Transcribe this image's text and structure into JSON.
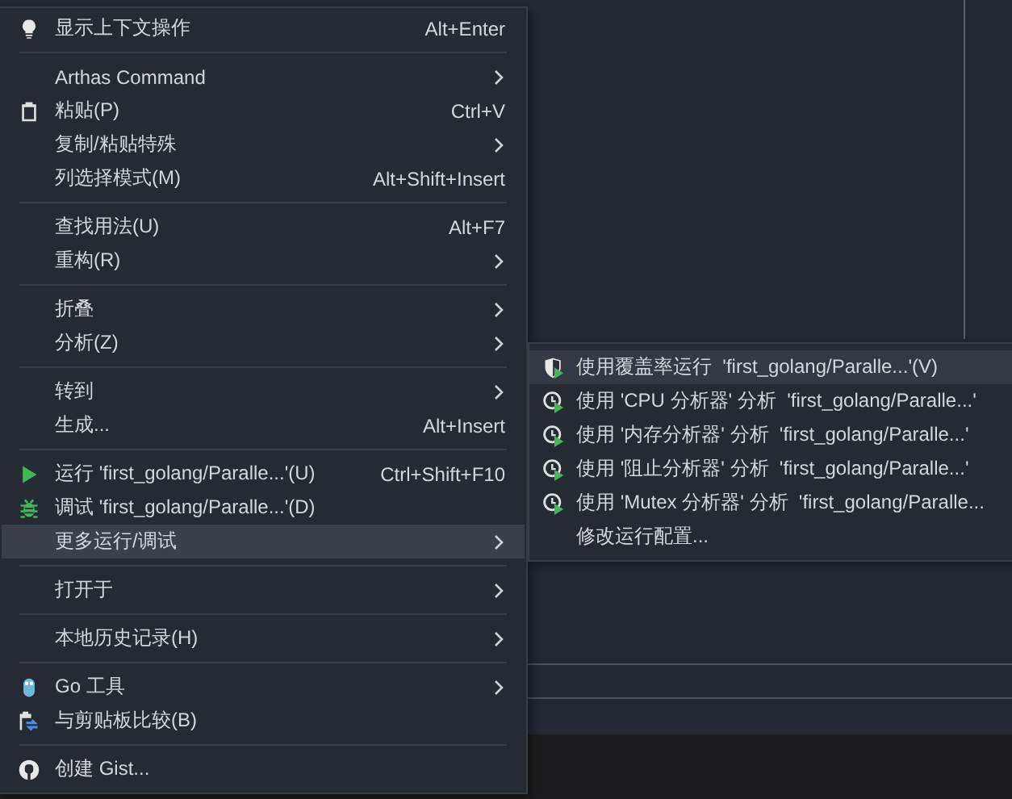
{
  "context_menu": {
    "groups": [
      [
        {
          "kind": "bulb",
          "label": "显示上下文操作",
          "shortcut": "Alt+Enter",
          "has_submenu": false,
          "selected": false
        }
      ],
      [
        {
          "label": "Arthas Command",
          "has_submenu": true,
          "selected": false
        },
        {
          "kind": "clipboard",
          "label": "粘贴(P)",
          "shortcut": "Ctrl+V",
          "has_submenu": false,
          "selected": false
        },
        {
          "label": "复制/粘贴特殊",
          "has_submenu": true,
          "selected": false
        },
        {
          "label": "列选择模式(M)",
          "shortcut": "Alt+Shift+Insert",
          "has_submenu": false,
          "selected": false
        }
      ],
      [
        {
          "label": "查找用法(U)",
          "shortcut": "Alt+F7",
          "has_submenu": false,
          "selected": false
        },
        {
          "label": "重构(R)",
          "has_submenu": true,
          "selected": false
        }
      ],
      [
        {
          "label": "折叠",
          "has_submenu": true,
          "selected": false
        },
        {
          "label": "分析(Z)",
          "has_submenu": true,
          "selected": false
        }
      ],
      [
        {
          "label": "转到",
          "has_submenu": true,
          "selected": false
        },
        {
          "label": "生成...",
          "shortcut": "Alt+Insert",
          "has_submenu": false,
          "selected": false
        }
      ],
      [
        {
          "kind": "run",
          "label": "运行 'first_golang/Paralle...'(U)",
          "shortcut": "Ctrl+Shift+F10",
          "has_submenu": false,
          "selected": false
        },
        {
          "kind": "debug",
          "label": "调试 'first_golang/Paralle...'(D)",
          "has_submenu": false,
          "selected": false
        },
        {
          "label": "更多运行/调试",
          "has_submenu": true,
          "selected": true
        }
      ],
      [
        {
          "label": "打开于",
          "has_submenu": true,
          "selected": false
        }
      ],
      [
        {
          "label": "本地历史记录(H)",
          "has_submenu": true,
          "selected": false
        }
      ],
      [
        {
          "kind": "gopher",
          "label": "Go 工具",
          "has_submenu": true,
          "selected": false
        },
        {
          "kind": "compare",
          "label": "与剪贴板比较(B)",
          "has_submenu": false,
          "selected": false
        }
      ],
      [
        {
          "kind": "github",
          "label": "创建 Gist...",
          "has_submenu": false,
          "selected": false
        }
      ]
    ]
  },
  "submenu": {
    "items": [
      {
        "kind": "coverage",
        "label": "使用覆盖率运行  'first_golang/Paralle...'(V)",
        "selected": true
      },
      {
        "kind": "profiler",
        "label": "使用 'CPU 分析器' 分析  'first_golang/Paralle...'",
        "selected": false
      },
      {
        "kind": "profiler",
        "label": "使用 '内存分析器' 分析  'first_golang/Paralle...'",
        "selected": false
      },
      {
        "kind": "profiler",
        "label": "使用 '阻止分析器' 分析  'first_golang/Paralle...'",
        "selected": false
      },
      {
        "kind": "profiler",
        "label": "使用 'Mutex 分析器' 分析  'first_golang/Paralle...",
        "selected": false
      },
      {
        "label": "修改运行配置...",
        "selected": false
      }
    ]
  }
}
